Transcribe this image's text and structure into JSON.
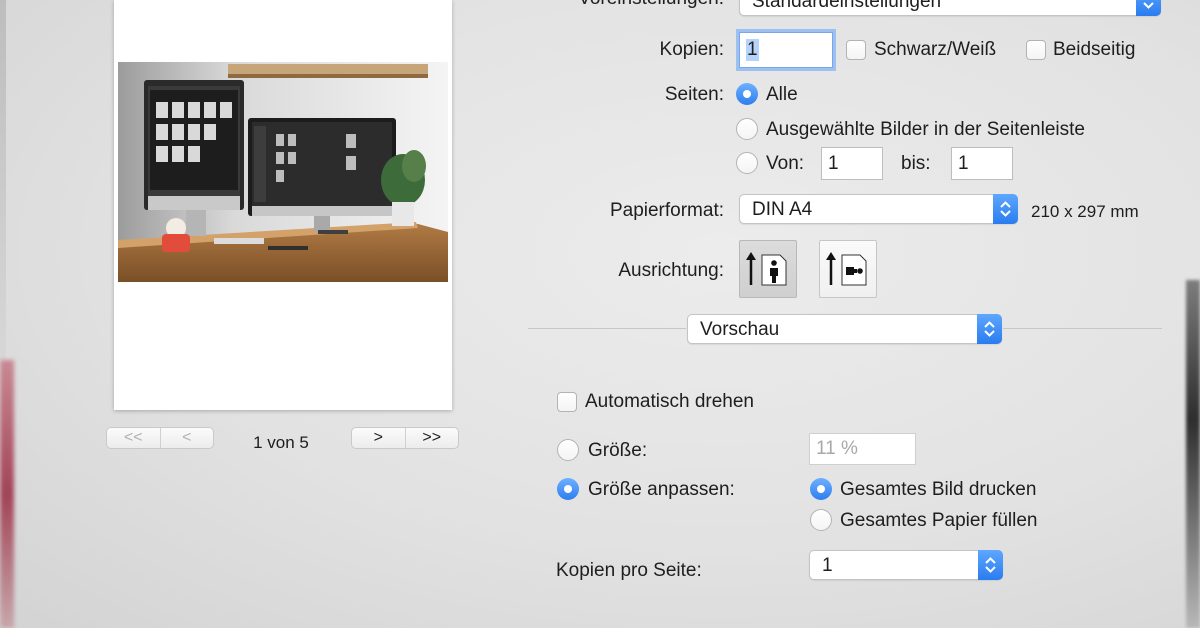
{
  "presets": {
    "label": "Voreinstellungen:",
    "value": "Standardeinstellungen"
  },
  "copies": {
    "label": "Kopien:",
    "value": "1"
  },
  "bw_checkbox": {
    "label": "Schwarz/Weiß",
    "checked": false
  },
  "duplex_checkbox": {
    "label": "Beidseitig",
    "checked": false
  },
  "pages": {
    "label": "Seiten:",
    "all_label": "Alle",
    "selected_label": "Ausgewählte Bilder in der Seitenleiste",
    "from_label": "Von:",
    "from_value": "1",
    "to_label": "bis:",
    "to_value": "1",
    "selected_option": "all"
  },
  "paper": {
    "label": "Papierformat:",
    "value": "DIN A4",
    "size": "210 x 297 mm"
  },
  "orientation": {
    "label": "Ausrichtung:",
    "selected": "portrait"
  },
  "section_popup": {
    "value": "Vorschau"
  },
  "auto_rotate": {
    "label": "Automatisch drehen",
    "checked": false
  },
  "size": {
    "label": "Größe:",
    "value": "11 %"
  },
  "scale_to_fit": {
    "label": "Größe anpassen:",
    "print_whole": "Gesamtes Bild drucken",
    "fill_paper": "Gesamtes Papier füllen",
    "selected": "print_whole"
  },
  "copies_per_page": {
    "label": "Kopien pro Seite:",
    "value": "1"
  },
  "pager": {
    "indicator": "1 von 5",
    "first": "<<",
    "prev": "<",
    "next": ">",
    "last": ">>"
  },
  "colors": {
    "accent": "#2f7ef0",
    "focus_ring": "#9cc0f0"
  }
}
